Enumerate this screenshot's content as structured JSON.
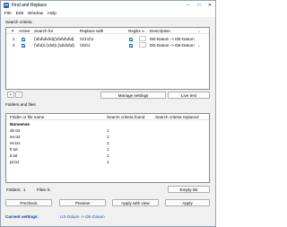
{
  "window": {
    "title": "Find and Replace"
  },
  "menu": [
    "File",
    "Edit",
    "Window",
    "Help"
  ],
  "search_criteria": {
    "group_label": "Search criteria",
    "columns": [
      "#",
      "Active",
      "Search for",
      "Replace with",
      "RegEx",
      "Description"
    ],
    "rows": [
      {
        "num": "1",
        "search": "(\\d\\d\\d\\d\\d)(\\d\\d\\d\\d\\d)",
        "replace": "\\2\\1\\2\\1",
        "description": "DE-Datum -> DE-Datum"
      },
      {
        "num": "2",
        "search": "(\\d\\d)\\.(\\d\\d)\\.(\\d\\d\\d\\d)",
        "replace": "\\3\\2\\1",
        "description": "DE-Datum -> DE-Datum"
      }
    ],
    "add_label": "+",
    "remove_label": "-",
    "manage_label": "Manage settings",
    "live_test_label": "Live test"
  },
  "folders": {
    "group_label": "Folders and files",
    "columns": [
      "Folder or file name",
      "Search criteria found",
      "Search criteria replaced"
    ],
    "folder_name": "Nonsense",
    "files": [
      {
        "name": "de.txt",
        "found": "1"
      },
      {
        "name": "en.txt",
        "found": "1"
      },
      {
        "name": "es.txt",
        "found": "1"
      },
      {
        "name": "fr.txt",
        "found": "1"
      },
      {
        "name": "it.txt",
        "found": "1"
      },
      {
        "name": "pt.txt",
        "found": "1"
      }
    ],
    "folders_count_label": "Folders:",
    "folders_count": "1",
    "files_count_label": "Files:",
    "files_count": "6",
    "empty_list_label": "Empty list"
  },
  "actions": {
    "precheck": "Precheck",
    "preview": "Preview",
    "apply_with_view": "Apply with view",
    "apply": "Apply"
  },
  "status": {
    "label": "Current settings:",
    "value": "US-Datum -> DE-Datum"
  }
}
